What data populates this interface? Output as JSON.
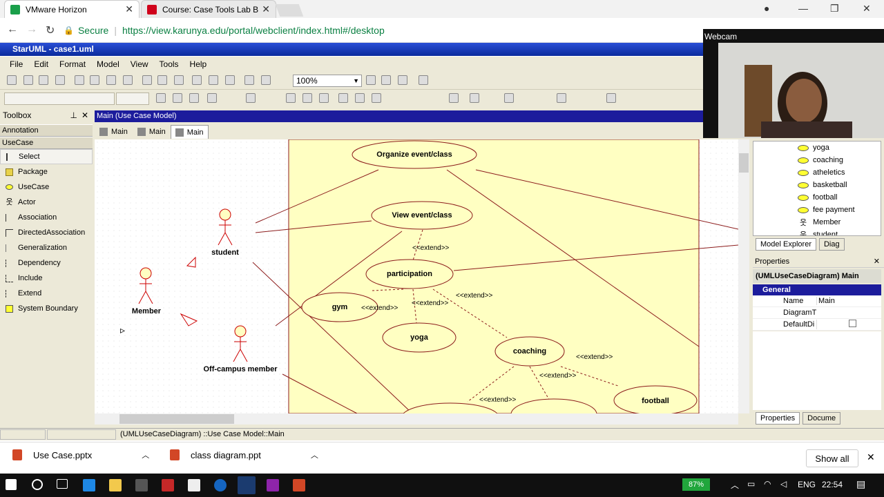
{
  "browser": {
    "tabs": [
      {
        "title": "VMware Horizon",
        "icon_color": "#1a9f4a"
      },
      {
        "title": "Course: Case Tools Lab B",
        "icon_color": "#d0021b"
      }
    ],
    "secure_label": "Secure",
    "url": "https://view.karunya.edu/portal/webclient/index.html#/desktop"
  },
  "app": {
    "title": "StarUML - case1.uml",
    "menu": [
      "File",
      "Edit",
      "Format",
      "Model",
      "View",
      "Tools",
      "Help"
    ],
    "zoom": "100%"
  },
  "toolbox": {
    "title": "Toolbox",
    "groups": [
      "Annotation",
      "UseCase"
    ],
    "items": [
      {
        "label": "Select",
        "icon": "cursor-icon"
      },
      {
        "label": "Package",
        "icon": "package-icon"
      },
      {
        "label": "UseCase",
        "icon": "usecase-icon"
      },
      {
        "label": "Actor",
        "icon": "actor-icon"
      },
      {
        "label": "Association",
        "icon": "association-icon"
      },
      {
        "label": "DirectedAssociation",
        "icon": "directed-association-icon"
      },
      {
        "label": "Generalization",
        "icon": "generalization-icon"
      },
      {
        "label": "Dependency",
        "icon": "dependency-icon"
      },
      {
        "label": "Include",
        "icon": "include-icon"
      },
      {
        "label": "Extend",
        "icon": "extend-icon"
      },
      {
        "label": "System Boundary",
        "icon": "system-boundary-icon"
      }
    ]
  },
  "diagram": {
    "header": "Main (Use Case Model)",
    "tabs": [
      "Main",
      "Main",
      "Main"
    ],
    "actors": [
      "student",
      "Member",
      "Off-campus member"
    ],
    "usecases": [
      "Organize event/class",
      "View event/class",
      "participation",
      "gym",
      "yoga",
      "coaching",
      "football"
    ],
    "extend_label": "<<extend>>"
  },
  "model_explorer": {
    "nodes": [
      {
        "label": "yoga",
        "type": "usecase"
      },
      {
        "label": "coaching",
        "type": "usecase"
      },
      {
        "label": "atheletics",
        "type": "usecase"
      },
      {
        "label": "basketball",
        "type": "usecase"
      },
      {
        "label": "football",
        "type": "usecase"
      },
      {
        "label": "fee payment",
        "type": "usecase"
      },
      {
        "label": "Member",
        "type": "actor"
      },
      {
        "label": "student",
        "type": "actor"
      }
    ],
    "tabs": [
      "Model Explorer",
      "Diag"
    ]
  },
  "properties": {
    "title": "Properties",
    "object": "(UMLUseCaseDiagram) Main",
    "group": "General",
    "rows": [
      {
        "key": "Name",
        "value": "Main"
      },
      {
        "key": "DiagramT",
        "value": ""
      },
      {
        "key": "DefaultDi",
        "value": ""
      }
    ],
    "bottom_tabs": [
      "Properties",
      "Docume"
    ]
  },
  "webcam": {
    "label": "Webcam"
  },
  "status": {
    "text": "(UMLUseCaseDiagram) ::Use Case Model::Main"
  },
  "downloads": {
    "items": [
      "Use Case.pptx",
      "class diagram.ppt"
    ],
    "show_all": "Show all"
  },
  "taskbar": {
    "battery": "87%",
    "lang": "ENG",
    "time": "22:54"
  }
}
